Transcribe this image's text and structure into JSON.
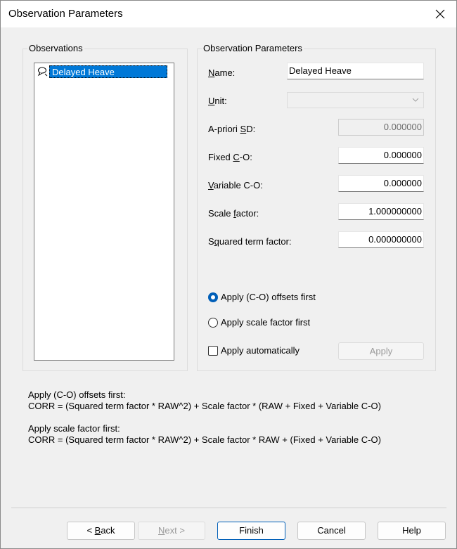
{
  "window": {
    "title": "Observation Parameters",
    "close_icon": "close-icon"
  },
  "observations": {
    "group_title": "Observations",
    "items": [
      {
        "label": "Delayed Heave",
        "icon": "balloon-icon",
        "selected": true
      }
    ]
  },
  "params": {
    "group_title": "Observation Parameters",
    "name": {
      "label": "Name:",
      "value": "Delayed Heave"
    },
    "unit": {
      "label": "Unit:",
      "value": ""
    },
    "apriori_sd": {
      "label": "A-priori SD:",
      "value": "0.000000"
    },
    "fixed_co": {
      "label": "Fixed C-O:",
      "value": "0.000000"
    },
    "variable_co": {
      "label": "Variable C-O:",
      "value": "0.000000"
    },
    "scale_factor": {
      "label": "Scale factor:",
      "value": "1.000000000"
    },
    "squared_term": {
      "label": "Squared term factor:",
      "value": "0.000000000"
    },
    "radio_offsets": "Apply (C-O) offsets first",
    "radio_scale": "Apply scale factor first",
    "apply_auto": "Apply automatically",
    "apply_button": "Apply"
  },
  "formulas": {
    "offsets_title": "Apply (C-O) offsets first:",
    "offsets_formula": "CORR = (Squared term factor * RAW^2) + Scale factor * (RAW + Fixed + Variable C-O)",
    "scale_title": "Apply scale factor first:",
    "scale_formula": "CORR = (Squared term factor * RAW^2) + Scale factor * RAW + (Fixed + Variable C-O)"
  },
  "footer": {
    "back_label": "< Back",
    "next_label": "Next >",
    "finish_label": "Finish",
    "cancel_label": "Cancel",
    "help_label": "Help"
  },
  "colors": {
    "selection": "#0078d7",
    "accent": "#005fb8"
  }
}
